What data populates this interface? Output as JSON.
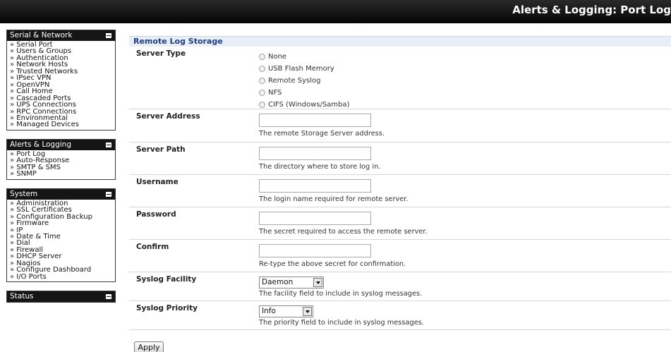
{
  "header": {
    "title": "Alerts & Logging: Port Log"
  },
  "sidebar": {
    "sections": [
      {
        "title": "Serial & Network",
        "items": [
          "Serial Port",
          "Users & Groups",
          "Authentication",
          "Network Hosts",
          "Trusted Networks",
          "IPsec VPN",
          "OpenVPN",
          "Call Home",
          "Cascaded Ports",
          "UPS Connections",
          "RPC Connections",
          "Environmental",
          "Managed Devices"
        ]
      },
      {
        "title": "Alerts & Logging",
        "items": [
          "Port Log",
          "Auto-Response",
          "SMTP & SMS",
          "SNMP"
        ]
      },
      {
        "title": "System",
        "items": [
          "Administration",
          "SSL Certificates",
          "Configuration Backup",
          "Firmware",
          "IP",
          "Date & Time",
          "Dial",
          "Firewall",
          "DHCP Server",
          "Nagios",
          "Configure Dashboard",
          "I/O Ports"
        ]
      },
      {
        "title": "Status",
        "items": []
      }
    ]
  },
  "main": {
    "section_title": "Remote Log Storage",
    "server_type": {
      "label": "Server Type",
      "options": [
        "None",
        "USB Flash Memory",
        "Remote Syslog",
        "NFS",
        "CIFS (Windows/Samba)"
      ]
    },
    "server_address": {
      "label": "Server Address",
      "value": "",
      "help": "The remote Storage Server address."
    },
    "server_path": {
      "label": "Server Path",
      "value": "",
      "help": "The directory where to store log in."
    },
    "username": {
      "label": "Username",
      "value": "",
      "help": "The login name required for remote server."
    },
    "password": {
      "label": "Password",
      "value": "",
      "help": "The secret required to access the remote server."
    },
    "confirm": {
      "label": "Confirm",
      "value": "",
      "help": "Re-type the above secret for confirmation."
    },
    "syslog_facility": {
      "label": "Syslog Facility",
      "value": "Daemon",
      "help": "The facility field to include in syslog messages."
    },
    "syslog_priority": {
      "label": "Syslog Priority",
      "value": "Info",
      "help": "The priority field to include in syslog messages."
    },
    "apply_label": "Apply"
  }
}
